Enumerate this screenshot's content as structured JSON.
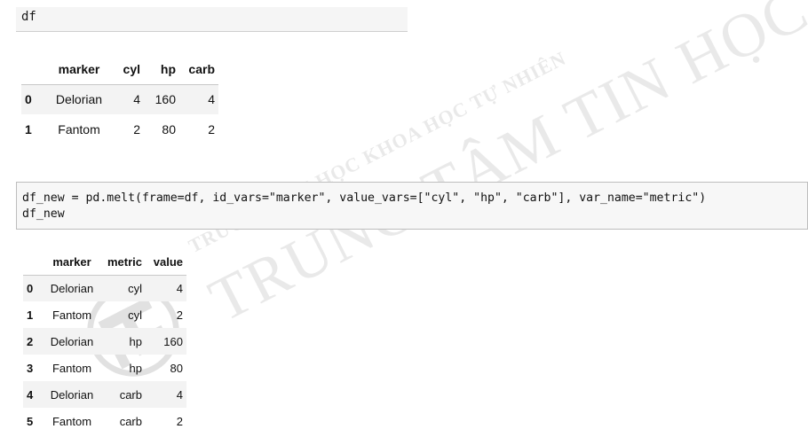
{
  "cell1": {
    "code": "df"
  },
  "table1": {
    "columns": [
      "",
      "marker",
      "cyl",
      "hp",
      "carb"
    ],
    "rows": [
      {
        "index": "0",
        "marker": "Delorian",
        "cyl": "4",
        "hp": "160",
        "carb": "4"
      },
      {
        "index": "1",
        "marker": "Fantom",
        "cyl": "2",
        "hp": "80",
        "carb": "2"
      }
    ]
  },
  "cell2": {
    "line1": "df_new = pd.melt(frame=df, id_vars=\"marker\", value_vars=[\"cyl\", \"hp\", \"carb\"], var_name=\"metric\")",
    "line2": "df_new"
  },
  "table2": {
    "columns": [
      "",
      "marker",
      "metric",
      "value"
    ],
    "rows": [
      {
        "index": "0",
        "marker": "Delorian",
        "metric": "cyl",
        "value": "4"
      },
      {
        "index": "1",
        "marker": "Fantom",
        "metric": "cyl",
        "value": "2"
      },
      {
        "index": "2",
        "marker": "Delorian",
        "metric": "hp",
        "value": "160"
      },
      {
        "index": "3",
        "marker": "Fantom",
        "metric": "hp",
        "value": "80"
      },
      {
        "index": "4",
        "marker": "Delorian",
        "metric": "carb",
        "value": "4"
      },
      {
        "index": "5",
        "marker": "Fantom",
        "metric": "carb",
        "value": "2"
      }
    ]
  },
  "watermark": {
    "line1": "TRƯỜNG ĐẠI HỌC KHOA HỌC TỰ NHIÊN",
    "line2": "TRUNG TÂM TIN HỌC"
  }
}
